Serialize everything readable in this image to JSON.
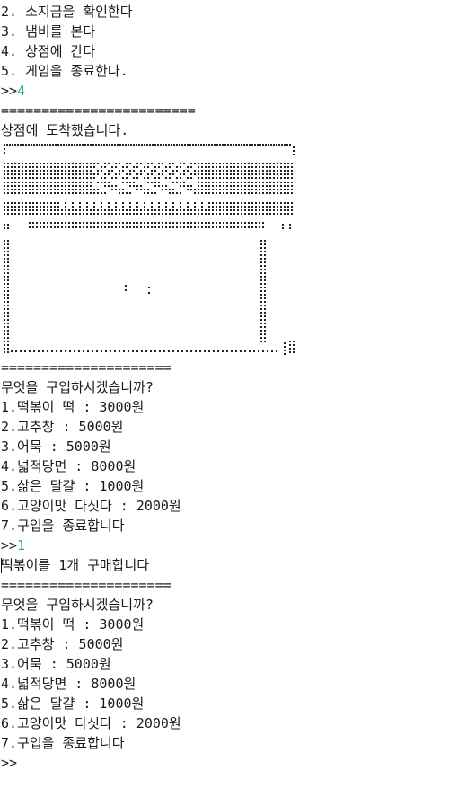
{
  "console": {
    "menu_lines": [
      "2. 소지금을 확인한다",
      "3. 냄비를 본다",
      "4. 상점에 간다",
      "5. 게임을 종료한다."
    ],
    "prompt": ">>",
    "input1": "4",
    "divider_long": "========================",
    "arrive_text": "상점에 도착했습니다.",
    "divider": "=====================",
    "shop_title": "무엇을 구입하시겠습니까?",
    "shop_items": [
      "1.떡볶이 떡 : 3000원",
      "2.고추창 : 5000원",
      "3.어묵 : 5000원",
      "4.넓적당면 : 8000원",
      "5.삶은 달걀 : 1000원",
      "6.고양이맛 다싯다 : 2000원",
      "7.구입을 종료합니다"
    ],
    "input2": "1",
    "purchase_msg": "떡볶이를 1개 구매합니다",
    "shop_title_2": "무엇을 구입하시겠습니까?",
    "shop_items_2": [
      "1.떡볶이 떡 : 3000원",
      "2.고추창 : 5000원",
      "3.어묵 : 5000원",
      "4.넓적당면 : 8000원",
      "5.삶은 달걀 : 1000원",
      "6.고양이맛 다싯다 : 2000원",
      "7.구입을 종료합니다"
    ],
    "final_prompt": ">>"
  },
  "colors": {
    "text": "#1a1a1a",
    "input": "#29a889",
    "background": "#ffffff"
  }
}
